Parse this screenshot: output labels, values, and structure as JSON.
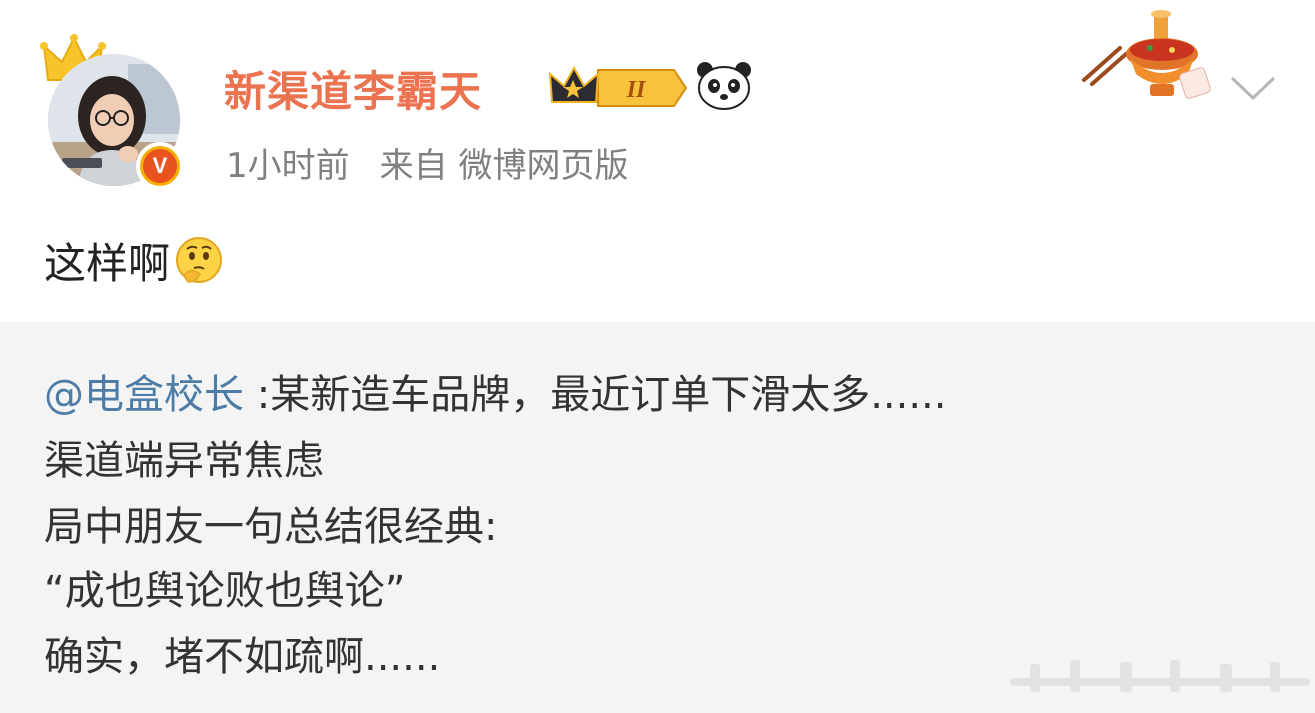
{
  "post": {
    "username": "新渠道李霸天",
    "level_badge": "II",
    "time": "1小时前",
    "source": "来自 微博网页版",
    "content": "这样啊",
    "verified_badge": "V",
    "icons": [
      "crown-decoration",
      "level-crown-badge",
      "panda-icon",
      "hotpot-decoration",
      "chevron-down-icon",
      "thinking-emoji"
    ]
  },
  "repost": {
    "mention": "@电盒校长",
    "line1_text": " :某新造车品牌，最近订单下滑太多......",
    "line2": "渠道端异常焦虑",
    "line3": "局中朋友一句总结很经典:",
    "line4": "“成也舆论败也舆论”",
    "line5": "确实，堵不如疏啊......"
  },
  "colors": {
    "username": "#eb7350",
    "meta": "#808080",
    "mention": "#4d7da6",
    "repost_bg": "#f4f4f4",
    "text": "#222222"
  }
}
